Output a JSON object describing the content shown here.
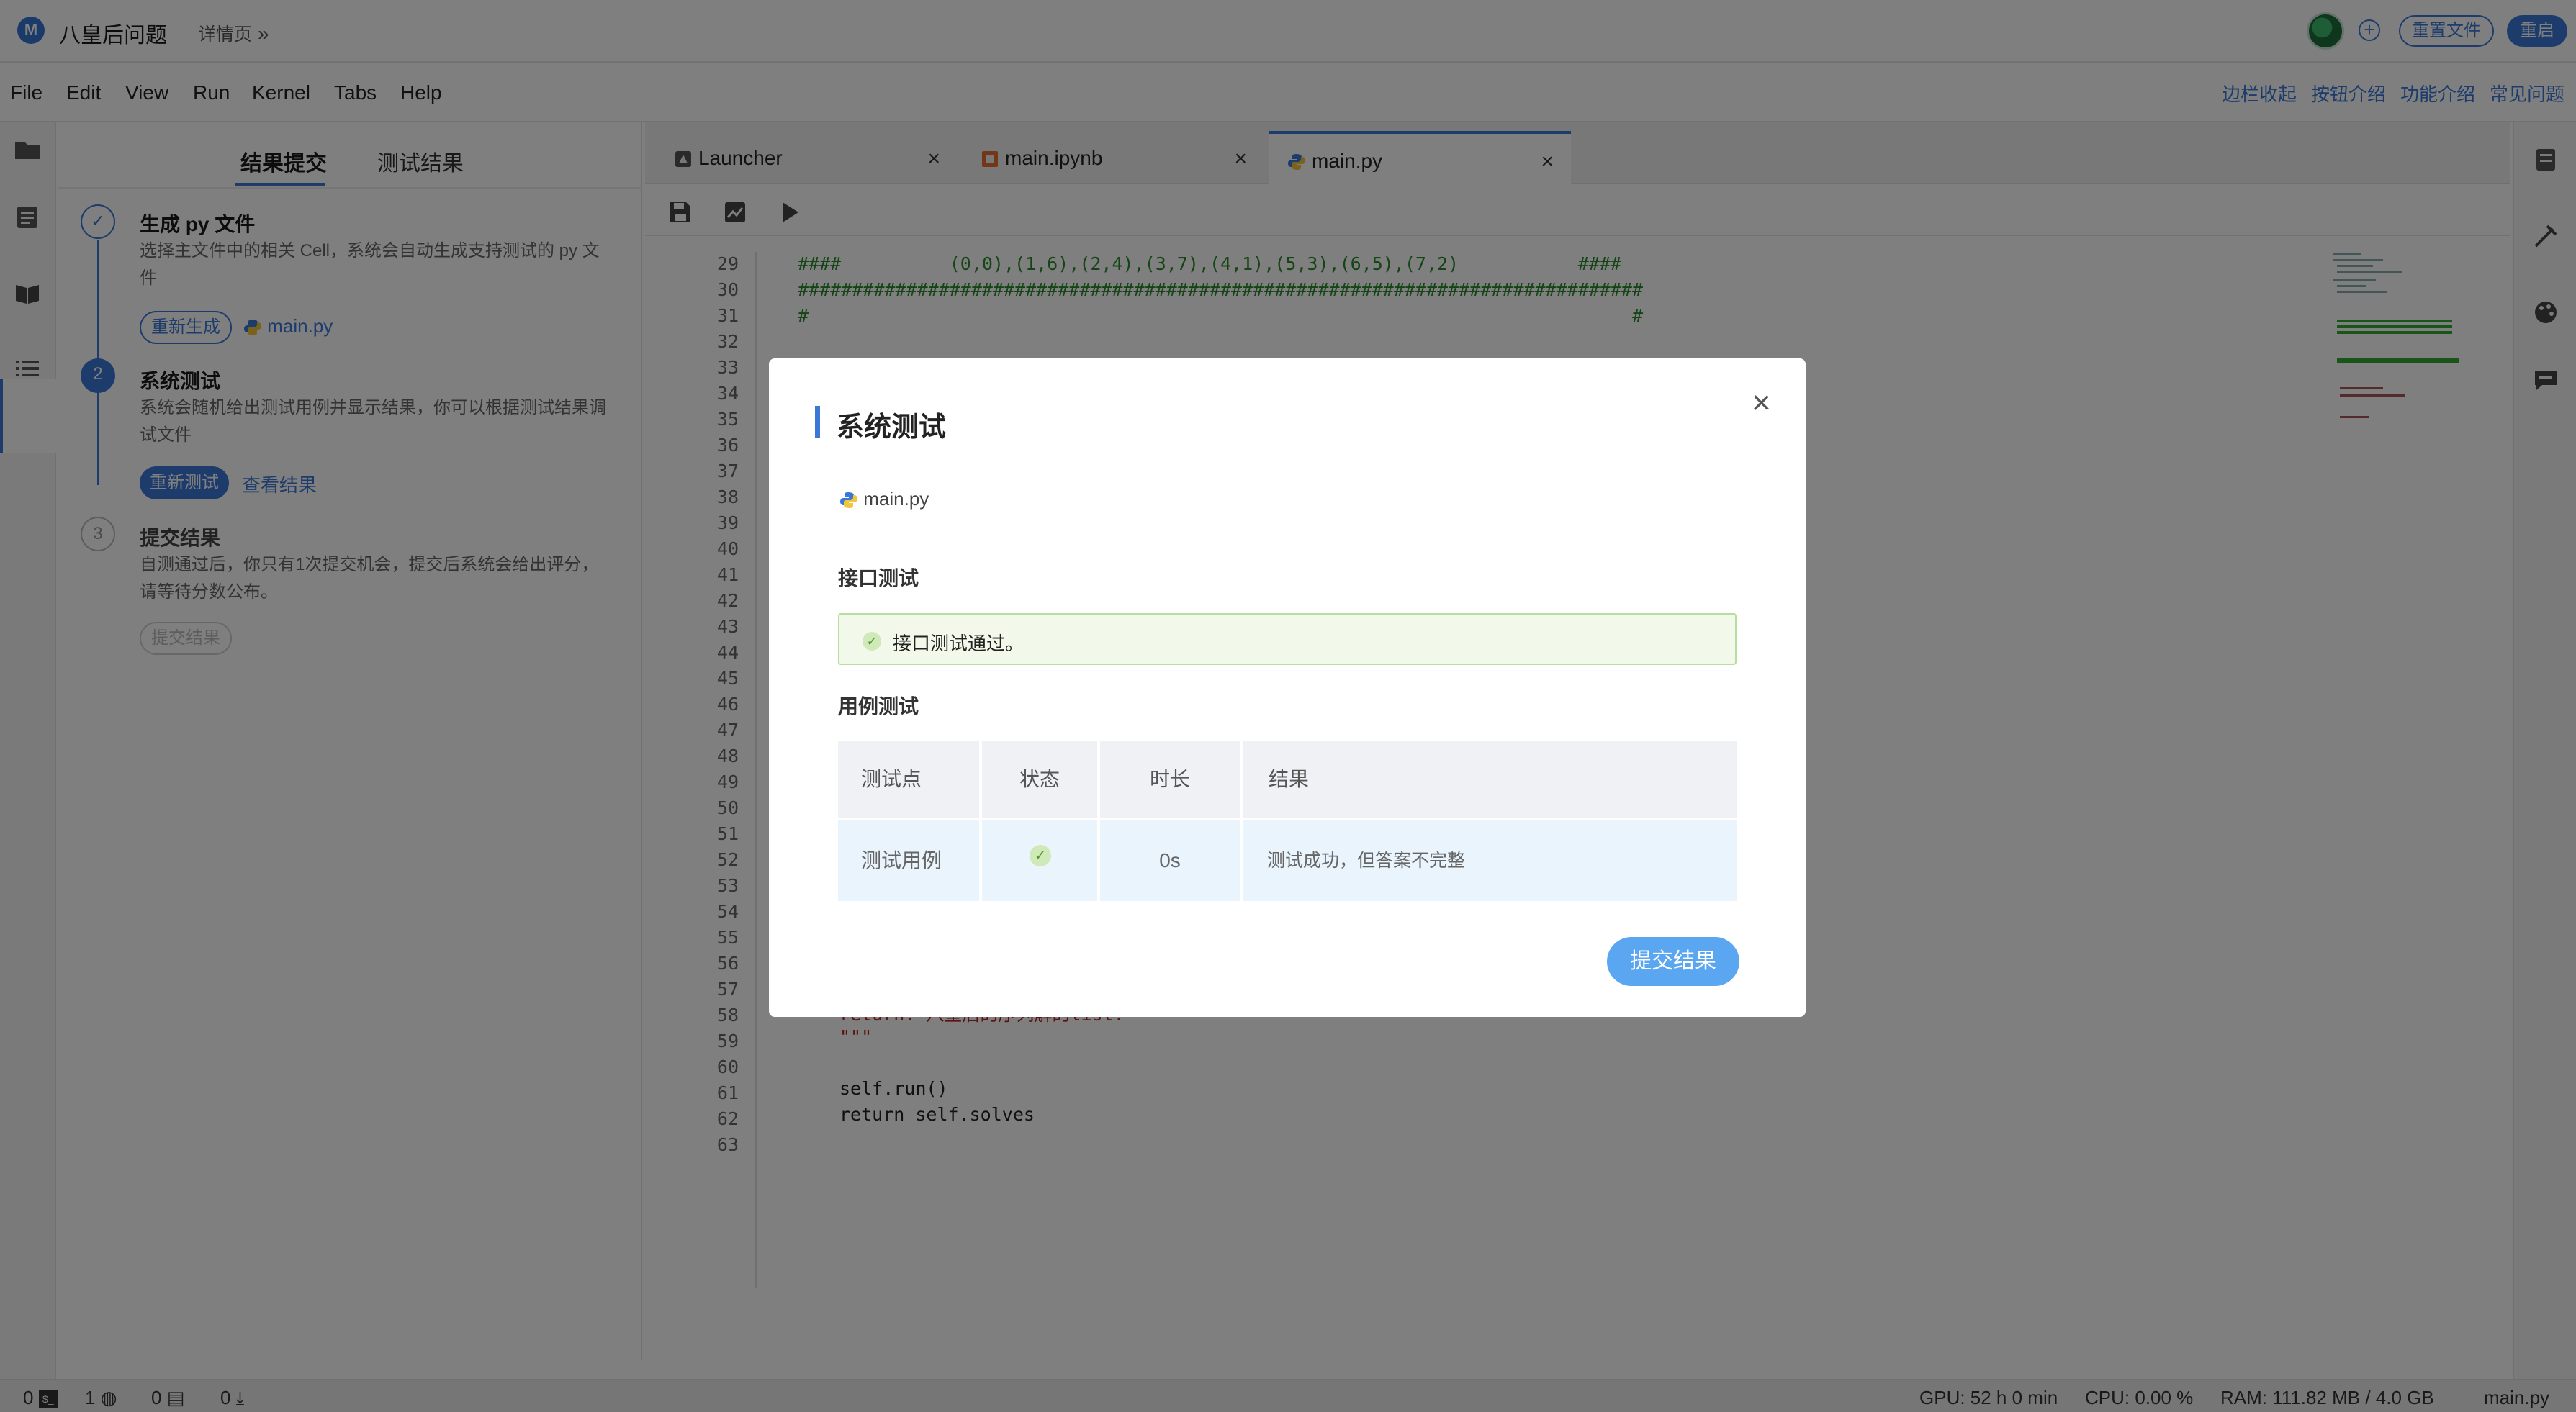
{
  "header": {
    "logo_letter": "M",
    "app_title": "八皇后问题",
    "detail_link": "详情页",
    "detail_chevron": "»",
    "reset_files_label": "重置文件",
    "restart_label": "重启"
  },
  "menu": {
    "items": [
      "File",
      "Edit",
      "View",
      "Run",
      "Kernel",
      "Tabs",
      "Help"
    ],
    "links": [
      "边栏收起",
      "按钮介绍",
      "功能介绍",
      "常见问题"
    ]
  },
  "left_panel": {
    "tabs": [
      "结果提交",
      "测试结果"
    ],
    "steps": [
      {
        "number": "✓",
        "title": "生成 py 文件",
        "desc": "选择主文件中的相关 Cell，系统会自动生成支持测试的 py 文件",
        "button": "重新生成",
        "file": "main.py"
      },
      {
        "number": "2",
        "title": "系统测试",
        "desc": "系统会随机给出测试用例并显示结果，你可以根据测试结果调试文件",
        "button": "重新测试",
        "link": "查看结果"
      },
      {
        "number": "3",
        "title": "提交结果",
        "desc": "自测通过后，你只有1次提交机会，提交后系统会给出评分，请等待分数公布。",
        "button": "提交结果"
      }
    ]
  },
  "editor": {
    "tabs": [
      {
        "label": "Launcher",
        "icon": "launcher-icon"
      },
      {
        "label": "main.ipynb",
        "icon": "notebook-icon"
      },
      {
        "label": "main.py",
        "icon": "python-icon",
        "active": true
      }
    ],
    "close_glyph": "×",
    "line_numbers": [
      "29",
      "30",
      "31",
      "32",
      "33",
      "34",
      "35",
      "36",
      "37",
      "38",
      "39",
      "40",
      "41",
      "42",
      "43",
      "44",
      "45",
      "46",
      "47",
      "48",
      "49",
      "50",
      "51",
      "52",
      "53",
      "54",
      "55",
      "56",
      "57",
      "58",
      "59",
      "60",
      "61",
      "62",
      "63"
    ],
    "code_top": [
      "####          (0,0),(1,6),(2,4),(3,7),(4,1),(5,3),(6,5),(7,2)           ####",
      "##############################################################################",
      "#                                                                            #"
    ],
    "code_bottom": [
      {
        "line": "58",
        "text": "return: 八皇后的序列解的list."
      },
      {
        "line": "59",
        "text": "\"\"\""
      },
      {
        "line": "61",
        "text": "self.run()"
      },
      {
        "line": "62",
        "text": "return self.solves"
      }
    ]
  },
  "status": {
    "terminals": "0",
    "kernels": "1",
    "sessions": "0",
    "downloads": "0",
    "gpu": "GPU: 52 h 0 min",
    "cpu": "CPU: 0.00 %",
    "ram": "RAM: 111.82 MB / 4.0 GB",
    "file": "main.py"
  },
  "modal": {
    "title": "系统测试",
    "file": "main.py",
    "interface_label": "接口测试",
    "interface_result": "接口测试通过。",
    "case_label": "用例测试",
    "table": {
      "headers": [
        "测试点",
        "状态",
        "时长",
        "结果"
      ],
      "rows": [
        {
          "point": "测试用例",
          "status": "success",
          "duration": "0s",
          "result": "测试成功，但答案不完整"
        }
      ]
    },
    "submit_label": "提交结果",
    "close_glyph": "×"
  },
  "colors": {
    "accent": "#3a78d8",
    "success_bg": "#f3f9ea",
    "success_border": "#b5df9a",
    "submit_button": "#5aa6f0",
    "overlay": "rgba(0,0,0,0.5)"
  }
}
